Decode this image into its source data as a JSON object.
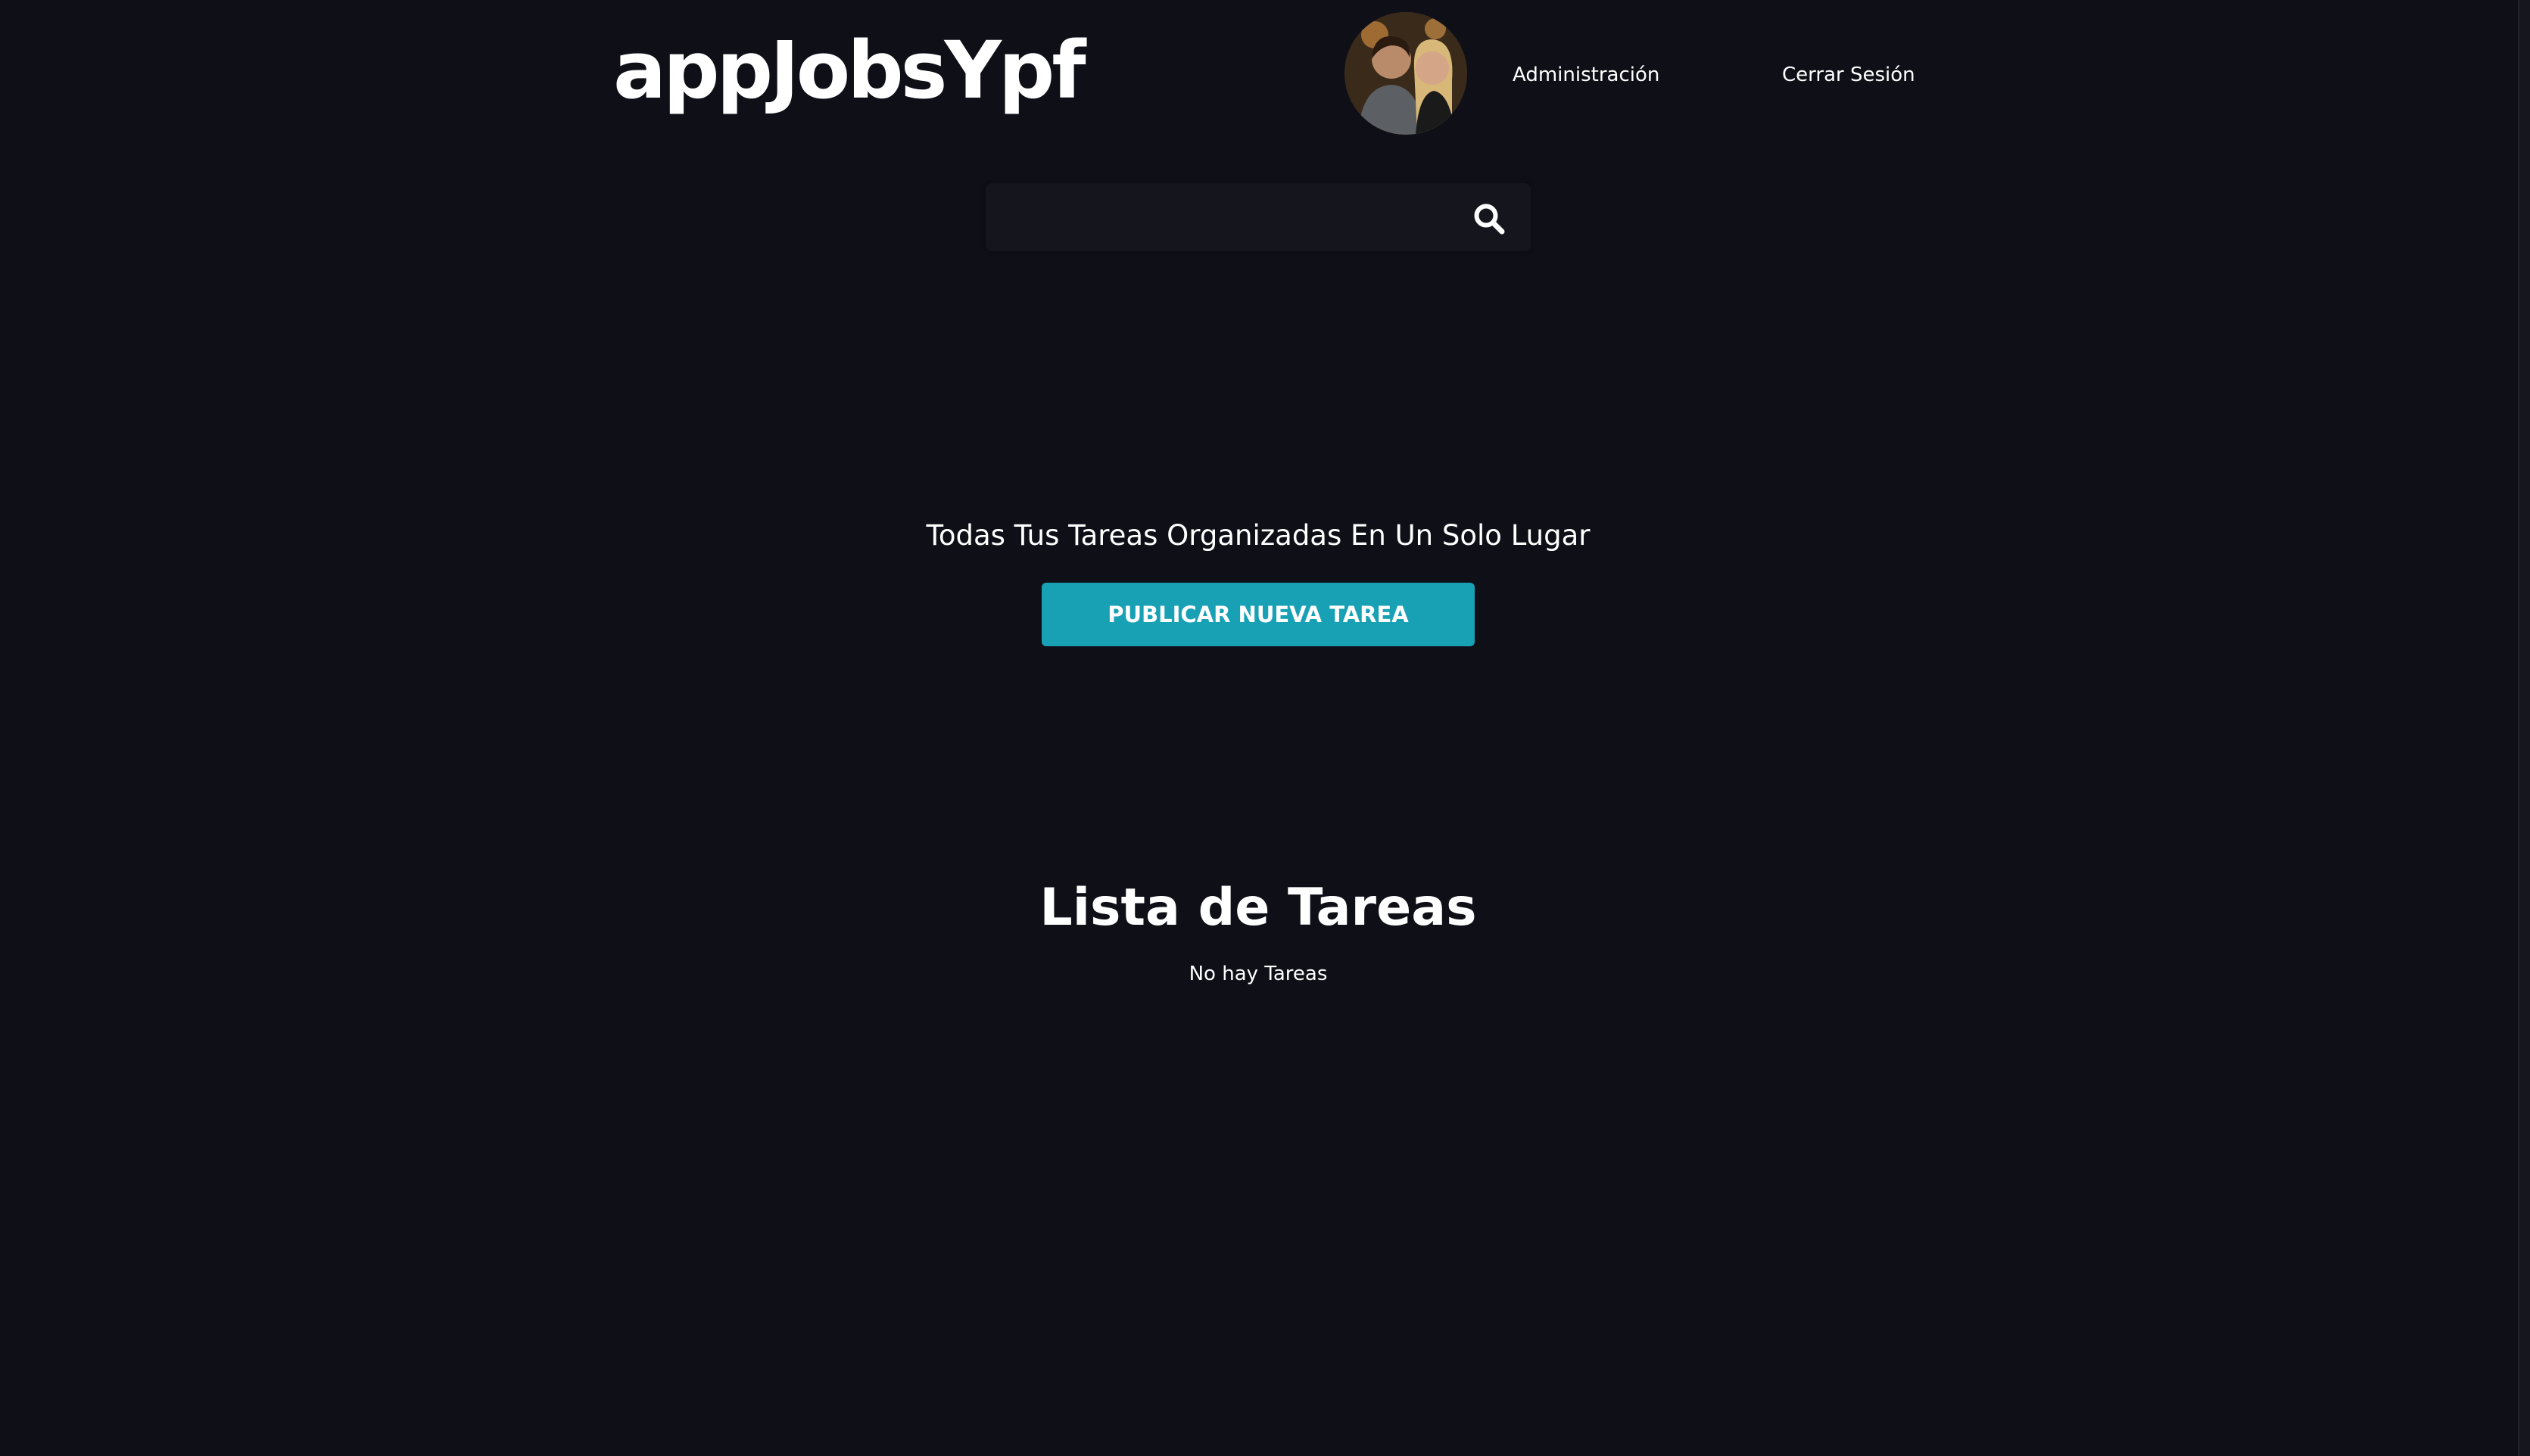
{
  "header": {
    "logo": "appJobsYpf",
    "nav": {
      "admin_label": "Administración",
      "logout_label": "Cerrar Sesión"
    },
    "avatar_icon": "user-avatar-photo"
  },
  "search": {
    "value": "",
    "placeholder": "",
    "icon": "search-icon"
  },
  "hero": {
    "tagline": "Todas Tus Tareas Organizadas En Un Solo Lugar",
    "cta_label": "PUBLICAR NUEVA TAREA"
  },
  "tasks": {
    "title": "Lista de Tareas",
    "empty_message": "No hay Tareas",
    "items": []
  },
  "colors": {
    "background": "#0f0f18",
    "accent": "#18a1b5",
    "text": "#ffffff"
  }
}
